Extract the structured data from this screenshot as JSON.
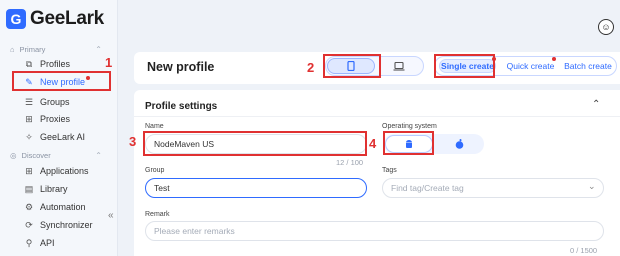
{
  "app": {
    "logo_text": "GeeLark",
    "logo_letter": "G"
  },
  "sidebar": {
    "sections": [
      {
        "label": "Primary"
      },
      {
        "label": "Discover"
      }
    ],
    "items": [
      {
        "label": "Profiles",
        "icon": "profiles-icon"
      },
      {
        "label": "New profile",
        "icon": "new-profile-icon"
      },
      {
        "label": "Groups",
        "icon": "groups-icon"
      },
      {
        "label": "Proxies",
        "icon": "proxies-icon"
      },
      {
        "label": "GeeLark AI",
        "icon": "ai-icon"
      },
      {
        "label": "Applications",
        "icon": "applications-icon"
      },
      {
        "label": "Library",
        "icon": "library-icon"
      },
      {
        "label": "Automation",
        "icon": "automation-icon"
      },
      {
        "label": "Synchronizer",
        "icon": "synchronizer-icon"
      },
      {
        "label": "API",
        "icon": "api-icon"
      }
    ],
    "collapse_glyph": "«"
  },
  "header": {
    "title": "New profile",
    "device_toggle": [
      "phone-icon",
      "laptop-icon"
    ],
    "modes": [
      "Single create",
      "Quick create",
      "Batch create"
    ]
  },
  "form": {
    "section_title": "Profile settings",
    "name": {
      "label": "Name",
      "value": "NodeMaven US",
      "counter": "12 / 100"
    },
    "os": {
      "label": "Operating system",
      "options": [
        "android-icon",
        "apple-icon"
      ]
    },
    "group": {
      "label": "Group",
      "value": "Test"
    },
    "tags": {
      "label": "Tags",
      "placeholder": "Find tag/Create tag"
    },
    "remark": {
      "label": "Remark",
      "placeholder": "Please enter remarks",
      "counter": "0 / 1500"
    }
  },
  "annotations": [
    "1",
    "2",
    "3",
    "4"
  ],
  "colors": {
    "accent": "#2f6bff",
    "annotation": "#e03131"
  }
}
